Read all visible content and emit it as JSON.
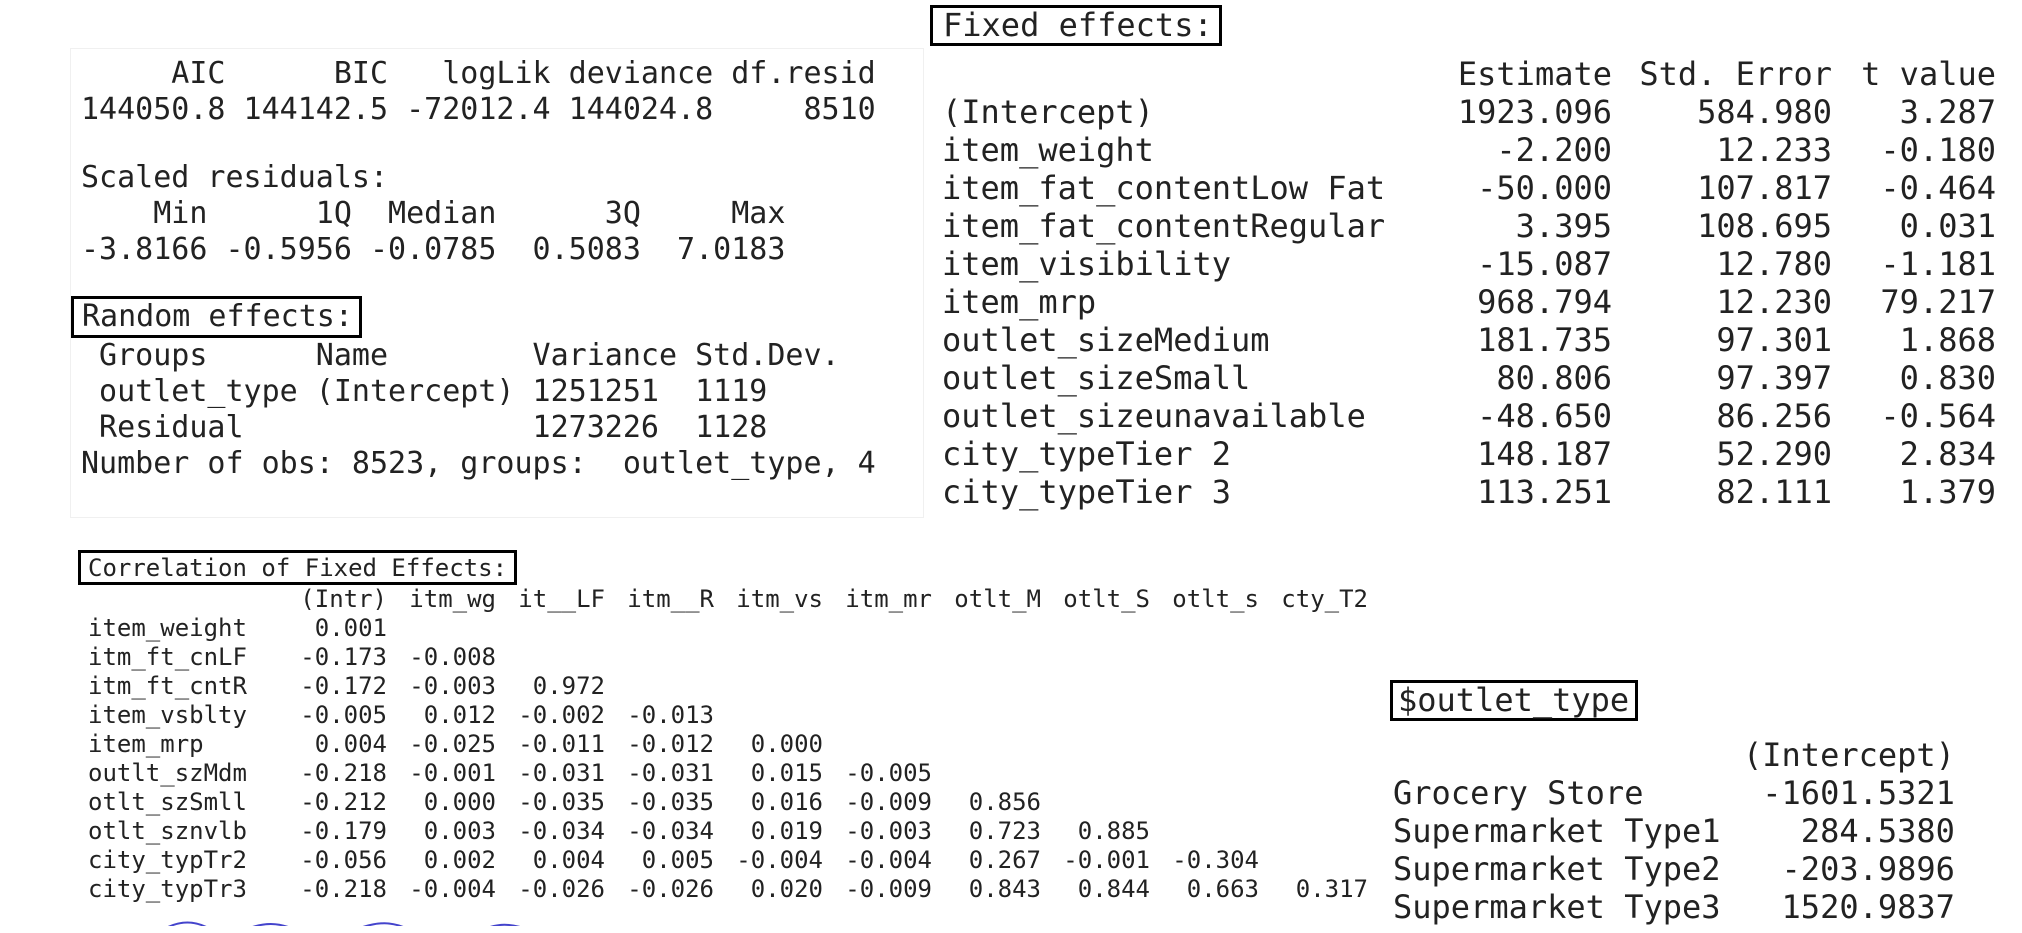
{
  "summary": {
    "header": "     AIC      BIC   logLik deviance df.resid",
    "values": "144050.8 144142.5 -72012.4 144024.8     8510",
    "scaled_residuals_label": "Scaled residuals:",
    "residual_header": "    Min      1Q  Median      3Q     Max",
    "residual_values": "-3.8166 -0.5956 -0.0785  0.5083  7.0183",
    "random_effects_label": "Random effects:",
    "random_effects_header": " Groups      Name        Variance Std.Dev.",
    "random_effects_row_1": " outlet_type (Intercept) 1251251  1119",
    "random_effects_row_2": " Residual                1273226  1128",
    "observation_note": "Number of obs: 8523, groups:  outlet_type, 4"
  },
  "fixed_effects": {
    "title": "Fixed effects:",
    "columns": [
      "Estimate",
      "Std. Error",
      "t value"
    ],
    "rows": [
      {
        "term": "(Intercept)",
        "estimate": "1923.096",
        "std_error": "584.980",
        "t_value": "3.287"
      },
      {
        "term": "item_weight",
        "estimate": "-2.200",
        "std_error": "12.233",
        "t_value": "-0.180"
      },
      {
        "term": "item_fat_contentLow Fat",
        "estimate": "-50.000",
        "std_error": "107.817",
        "t_value": "-0.464"
      },
      {
        "term": "item_fat_contentRegular",
        "estimate": "3.395",
        "std_error": "108.695",
        "t_value": "0.031"
      },
      {
        "term": "item_visibility",
        "estimate": "-15.087",
        "std_error": "12.780",
        "t_value": "-1.181"
      },
      {
        "term": "item_mrp",
        "estimate": "968.794",
        "std_error": "12.230",
        "t_value": "79.217"
      },
      {
        "term": "outlet_sizeMedium",
        "estimate": "181.735",
        "std_error": "97.301",
        "t_value": "1.868"
      },
      {
        "term": "outlet_sizeSmall",
        "estimate": "80.806",
        "std_error": "97.397",
        "t_value": "0.830"
      },
      {
        "term": "outlet_sizeunavailable",
        "estimate": "-48.650",
        "std_error": "86.256",
        "t_value": "-0.564"
      },
      {
        "term": "city_typeTier 2",
        "estimate": "148.187",
        "std_error": "52.290",
        "t_value": "2.834"
      },
      {
        "term": "city_typeTier 3",
        "estimate": "113.251",
        "std_error": "82.111",
        "t_value": "1.379"
      }
    ]
  },
  "correlation": {
    "title": "Correlation of Fixed Effects:",
    "columns": [
      "(Intr)",
      "itm_wg",
      "it__LF",
      "itm__R",
      "itm_vs",
      "itm_mr",
      "otlt_M",
      "otlt_S",
      "otlt_s",
      "cty_T2"
    ],
    "rows": [
      {
        "label": "item_weight",
        "values": [
          "0.001",
          "",
          "",
          "",
          "",
          "",
          "",
          "",
          "",
          ""
        ]
      },
      {
        "label": "itm_ft_cnLF",
        "values": [
          "-0.173",
          "-0.008",
          "",
          "",
          "",
          "",
          "",
          "",
          "",
          ""
        ]
      },
      {
        "label": "itm_ft_cntR",
        "values": [
          "-0.172",
          "-0.003",
          "0.972",
          "",
          "",
          "",
          "",
          "",
          "",
          ""
        ]
      },
      {
        "label": "item_vsblty",
        "values": [
          "-0.005",
          "0.012",
          "-0.002",
          "-0.013",
          "",
          "",
          "",
          "",
          "",
          ""
        ]
      },
      {
        "label": "item_mrp",
        "values": [
          "0.004",
          "-0.025",
          "-0.011",
          "-0.012",
          "0.000",
          "",
          "",
          "",
          "",
          ""
        ]
      },
      {
        "label": "outlt_szMdm",
        "values": [
          "-0.218",
          "-0.001",
          "-0.031",
          "-0.031",
          "0.015",
          "-0.005",
          "",
          "",
          "",
          ""
        ]
      },
      {
        "label": "otlt_szSmll",
        "values": [
          "-0.212",
          "0.000",
          "-0.035",
          "-0.035",
          "0.016",
          "-0.009",
          "0.856",
          "",
          "",
          ""
        ]
      },
      {
        "label": "otlt_sznvlb",
        "values": [
          "-0.179",
          "0.003",
          "-0.034",
          "-0.034",
          "0.019",
          "-0.003",
          "0.723",
          "0.885",
          "",
          ""
        ]
      },
      {
        "label": "city_typTr2",
        "values": [
          "-0.056",
          "0.002",
          "0.004",
          "0.005",
          "-0.004",
          "-0.004",
          "0.267",
          "-0.001",
          "-0.304",
          ""
        ]
      },
      {
        "label": "city_typTr3",
        "values": [
          "-0.218",
          "-0.004",
          "-0.026",
          "-0.026",
          "0.020",
          "-0.009",
          "0.843",
          "0.844",
          "0.663",
          "0.317"
        ]
      }
    ]
  },
  "outlet_type": {
    "title": "$outlet_type",
    "column": "(Intercept)",
    "rows": [
      {
        "label": "Grocery Store",
        "value": "-1601.5321"
      },
      {
        "label": "Supermarket Type1",
        "value": "284.5380"
      },
      {
        "label": "Supermarket Type2",
        "value": "-203.9896"
      },
      {
        "label": "Supermarket Type3",
        "value": "1520.9837"
      }
    ]
  },
  "colors": {
    "text": "#222222",
    "title_border": "#000000",
    "background": "#ffffff",
    "partial_blue_text": "#4444cc"
  }
}
